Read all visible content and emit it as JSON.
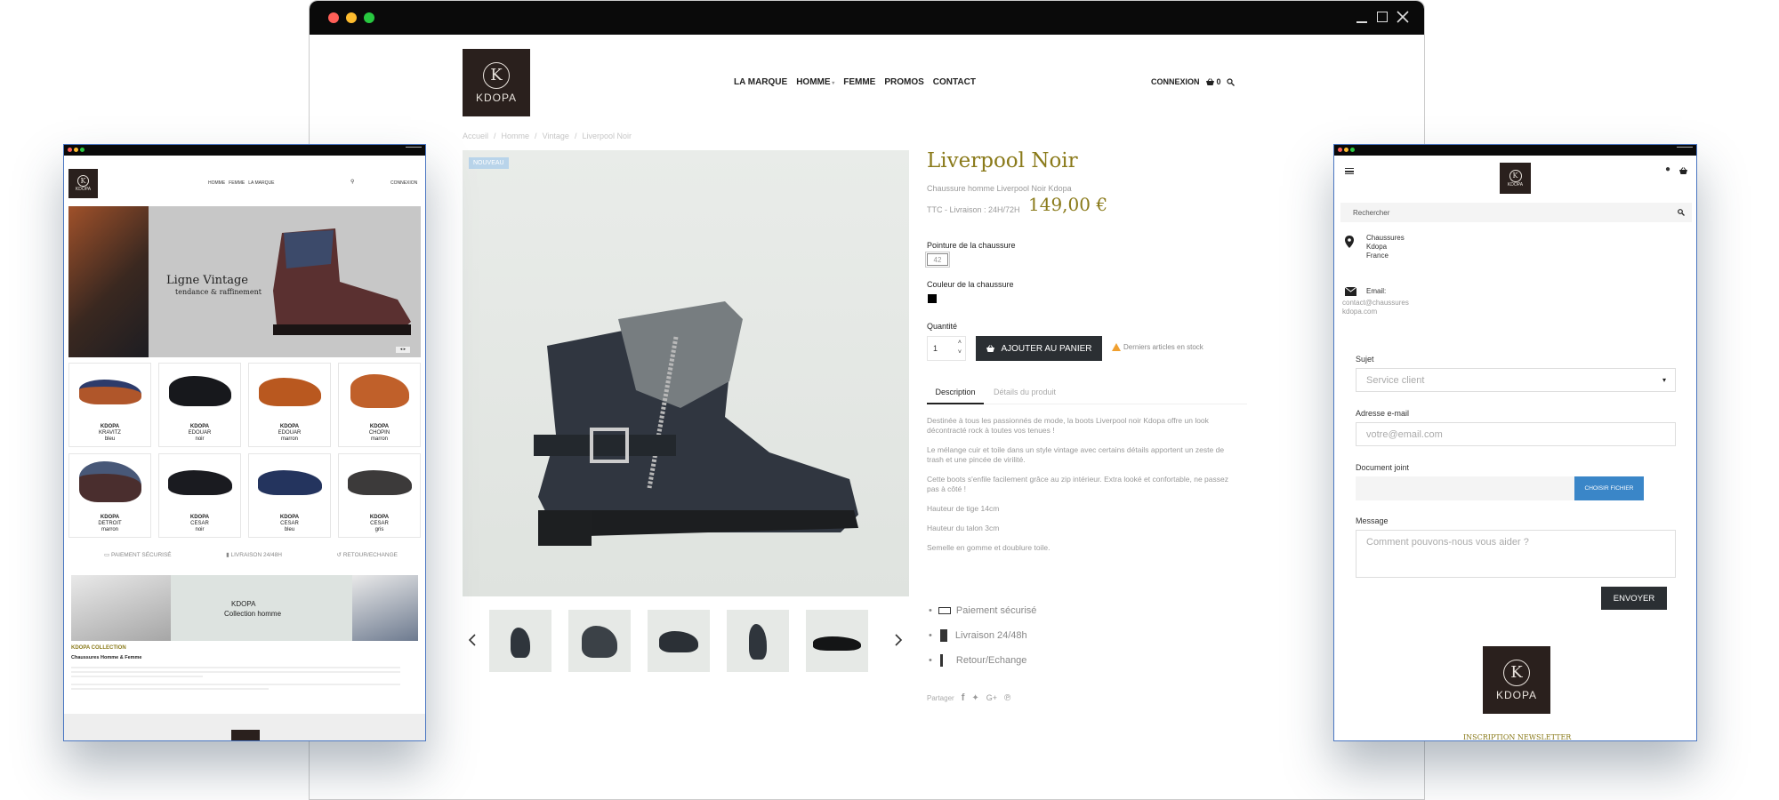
{
  "brand": {
    "name": "KDOPA",
    "monogram": "K"
  },
  "main": {
    "nav": [
      "LA MARQUE",
      "HOMME",
      "FEMME",
      "PROMOS",
      "CONTACT"
    ],
    "connexion": "CONNEXION",
    "cart_count": "0",
    "breadcrumb": [
      "Accueil",
      "Homme",
      "Vintage",
      "Liverpool Noir"
    ],
    "badge": "NOUVEAU",
    "product": {
      "title": "Liverpool Noir",
      "subtitle": "Chaussure homme Liverpool Noir Kdopa",
      "ttc": "TTC - Livraison : 24H/72H",
      "price": "149,00 €",
      "size_label": "Pointure de la chaussure",
      "size_value": "42",
      "color_label": "Couleur de la chaussure",
      "qty_label": "Quantité",
      "qty_value": "1",
      "add_to_cart": "AJOUTER AU PANIER",
      "stock_note": "Derniers articles en stock",
      "tabs": [
        "Description",
        "Détails du produit"
      ],
      "description": [
        "Destinée à tous les passionnés de mode, la boots Liverpool noir Kdopa offre un look décontracté rock à toutes vos tenues !",
        "Le mélange cuir et toile dans un style vintage avec certains détails apportent un zeste de trash et une pincée de virilité.",
        "Cette boots s'enfile facilement grâce au zip intérieur. Extra looké et confortable, ne passez pas à côté !",
        "Hauteur de tige 14cm",
        "Hauteur du talon 3cm",
        "Semelle en gomme et doublure toile."
      ],
      "reassurance": [
        "Paiement sécurisé",
        "Livraison 24/48h",
        "Retour/Echange"
      ],
      "share": "Partager"
    }
  },
  "left": {
    "nav": [
      "HOMME",
      "FEMME",
      "LA MARQUE"
    ],
    "connexion": "CONNEXION",
    "hero_title": "Ligne Vintage",
    "hero_sub": "tendance & raffinement",
    "products": [
      {
        "brand": "KDOPA",
        "model": "KRAVITZ",
        "color": "bleu"
      },
      {
        "brand": "KDOPA",
        "model": "EDOUAR",
        "color": "noir"
      },
      {
        "brand": "KDOPA",
        "model": "EDOUAR",
        "color": "marron"
      },
      {
        "brand": "KDOPA",
        "model": "CHOPIN",
        "color": "marron"
      },
      {
        "brand": "KDOPA",
        "model": "DETROIT",
        "color": "marron"
      },
      {
        "brand": "KDOPA",
        "model": "CESAR",
        "color": "noir"
      },
      {
        "brand": "KDOPA",
        "model": "CESAR",
        "color": "bleu"
      },
      {
        "brand": "KDOPA",
        "model": "CESAR",
        "color": "gris"
      }
    ],
    "features": [
      "PAIEMENT SÉCURISÉ",
      "LIVRAISON 24/48H",
      "RETOUR/ECHANGE"
    ],
    "banner_title": "KDOPA",
    "banner_sub": "Collection homme",
    "collection_title": "KDOPA COLLECTION",
    "collection_sub": "Chaussures Homme & Femme"
  },
  "right": {
    "search_placeholder": "Rechercher",
    "address": [
      "Chaussures",
      "Kdopa",
      "France"
    ],
    "email_label": "Email:",
    "email_value": [
      "contact@chaussures",
      "kdopa.com"
    ],
    "subject_label": "Sujet",
    "subject_value": "Service client",
    "email_field_label": "Adresse e-mail",
    "email_placeholder": "votre@email.com",
    "attach_label": "Document joint",
    "attach_button": "CHOISIR FICHIER",
    "message_label": "Message",
    "message_placeholder": "Comment pouvons-nous vous aider ?",
    "send": "ENVOYER",
    "newsletter": "INSCRIPTION NEWSLETTER"
  },
  "colors": {
    "accent": "#8a7a1a",
    "dark": "#2b2f33",
    "logo_bg": "#2a201d",
    "blue_button": "#3a86c8"
  }
}
